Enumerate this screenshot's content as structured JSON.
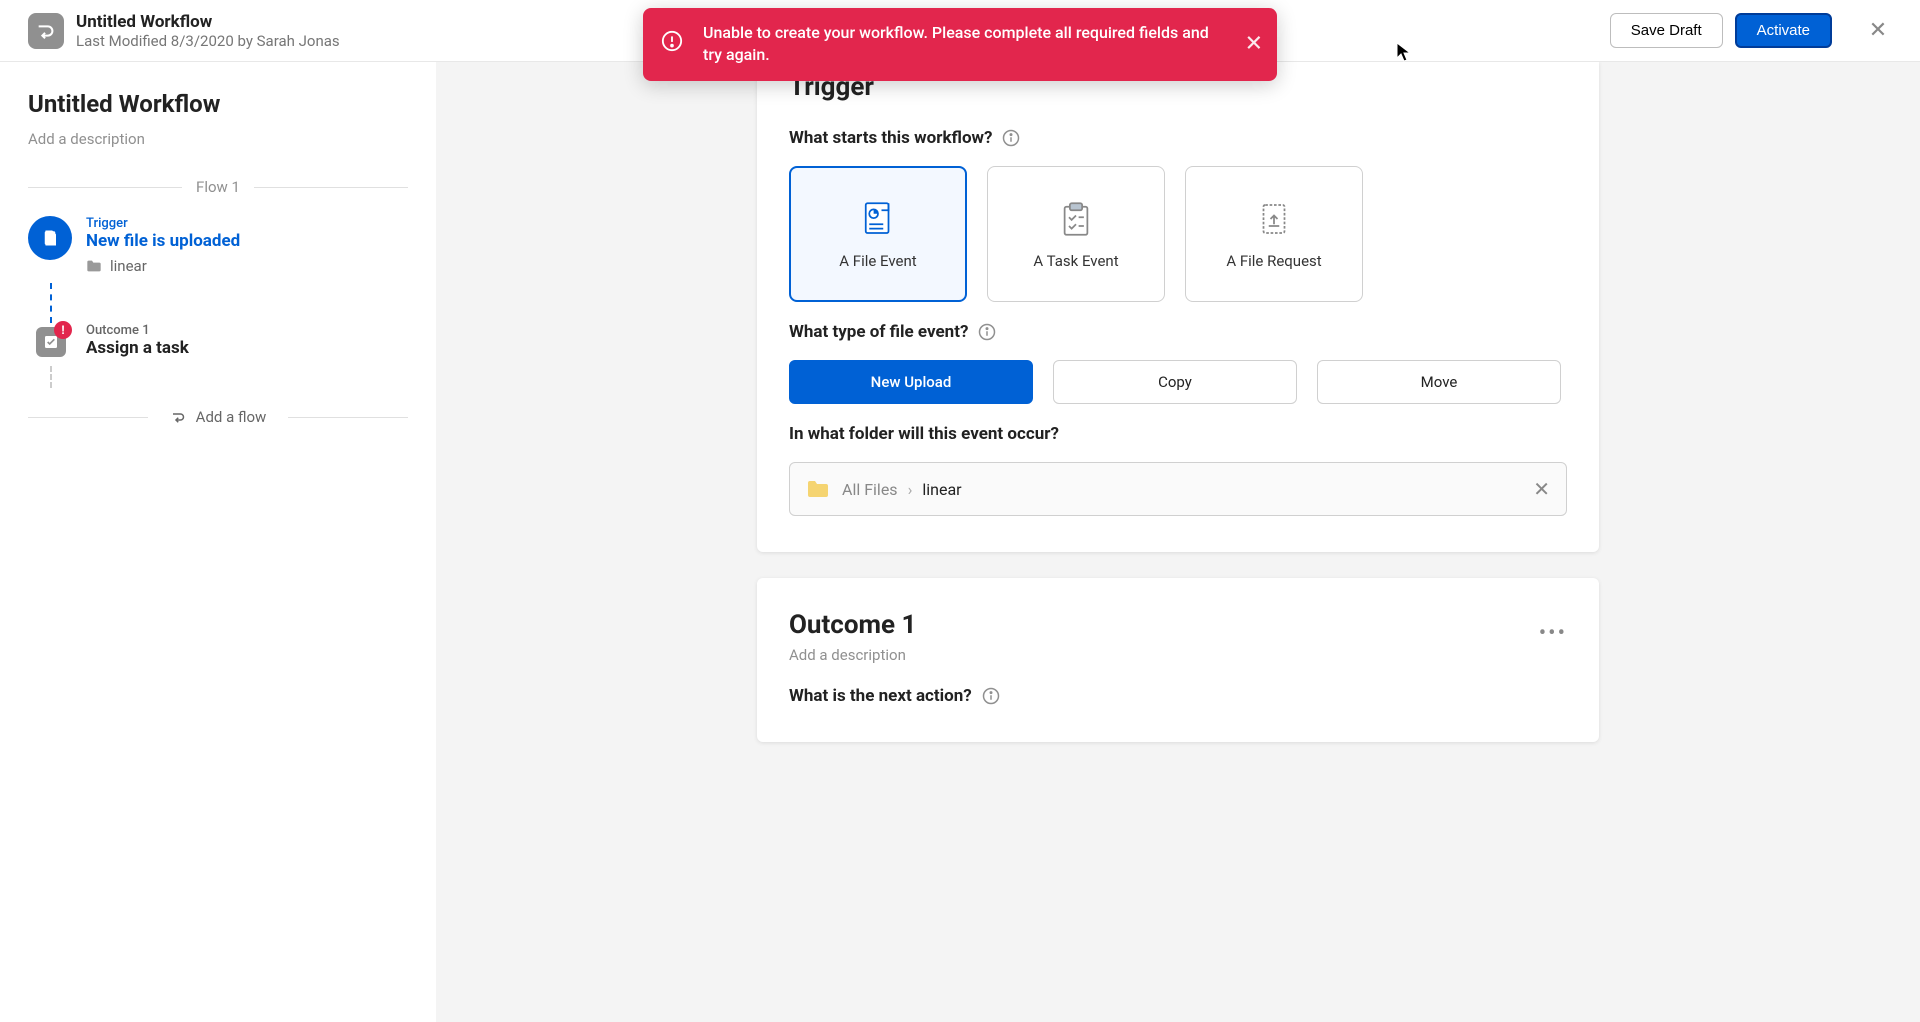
{
  "header": {
    "workflow_title": "Untitled Workflow",
    "last_modified": "Last Modified 8/3/2020 by Sarah Jonas",
    "save_draft": "Save Draft",
    "activate": "Activate"
  },
  "alert": {
    "message": "Unable to create your workflow. Please complete all required fields and try again."
  },
  "sidebar": {
    "title": "Untitled Workflow",
    "description_placeholder": "Add a description",
    "flow_label": "Flow 1",
    "trigger": {
      "label": "Trigger",
      "title": "New file is uploaded",
      "folder": "linear"
    },
    "outcome": {
      "label": "Outcome 1",
      "title": "Assign a task",
      "has_error": true
    },
    "add_flow": "Add a flow"
  },
  "trigger_card": {
    "heading": "Trigger",
    "q_starts": "What starts this workflow?",
    "tiles": [
      {
        "label": "A File Event",
        "selected": true
      },
      {
        "label": "A Task Event",
        "selected": false
      },
      {
        "label": "A File Request",
        "selected": false
      }
    ],
    "q_type": "What type of file event?",
    "event_types": [
      {
        "label": "New Upload",
        "selected": true
      },
      {
        "label": "Copy",
        "selected": false
      },
      {
        "label": "Move",
        "selected": false
      }
    ],
    "q_folder": "In what folder will this event occur?",
    "breadcrumb_root": "All Files",
    "breadcrumb_current": "linear"
  },
  "outcome_card": {
    "heading": "Outcome 1",
    "description_placeholder": "Add a description",
    "q_next": "What is the next action?"
  }
}
